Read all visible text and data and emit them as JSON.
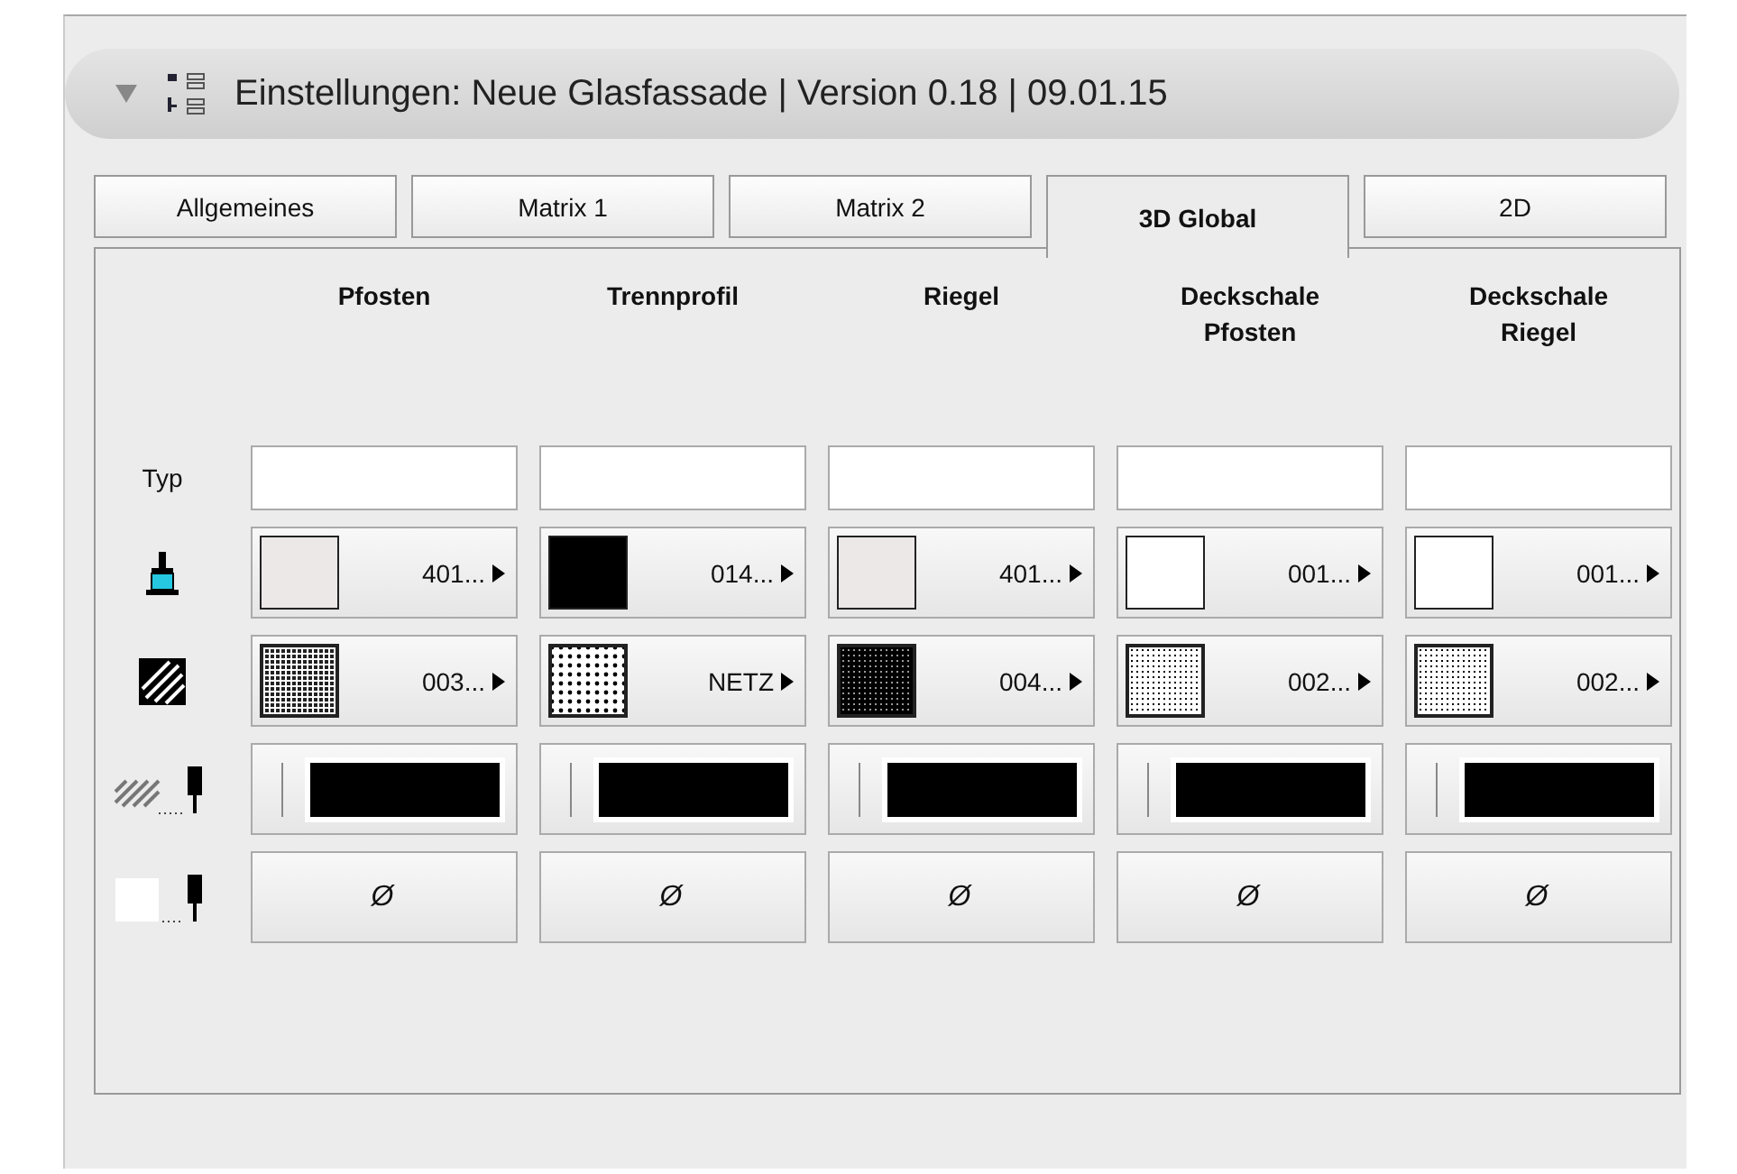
{
  "header": {
    "title": "Einstellungen: Neue Glasfassade | Version 0.18 | 09.01.15",
    "expanded": true
  },
  "tabs": [
    {
      "label": "Allgemeines",
      "selected": false
    },
    {
      "label": "Matrix 1",
      "selected": false
    },
    {
      "label": "Matrix 2",
      "selected": false
    },
    {
      "label": "3D Global",
      "selected": true
    },
    {
      "label": "2D",
      "selected": false
    }
  ],
  "columns": [
    "Pfosten",
    "Trennprofil",
    "Riegel",
    "Deckschale\nPfosten",
    "Deckschale\nRiegel"
  ],
  "type_row": {
    "label": "Typ"
  },
  "material_row": [
    {
      "color": "#ece8e8",
      "value": "401..."
    },
    {
      "color": "#000000",
      "value": "014..."
    },
    {
      "color": "#ece8e8",
      "value": "401..."
    },
    {
      "color": "#ffffff",
      "value": "001..."
    },
    {
      "color": "#ffffff",
      "value": "001..."
    }
  ],
  "fill_row": [
    {
      "kind": "fine-dots",
      "value": "003..."
    },
    {
      "kind": "coarse-dots",
      "value": "NETZ"
    },
    {
      "kind": "dark-grid",
      "value": "004..."
    },
    {
      "kind": "light-grid",
      "value": "002..."
    },
    {
      "kind": "light-grid",
      "value": "002..."
    }
  ],
  "pen_row": [
    {
      "color": "#000000"
    },
    {
      "color": "#000000"
    },
    {
      "color": "#000000"
    },
    {
      "color": "#000000"
    },
    {
      "color": "#000000"
    }
  ],
  "empty_pen_row": [
    "Ø",
    "Ø",
    "Ø",
    "Ø",
    "Ø"
  ]
}
